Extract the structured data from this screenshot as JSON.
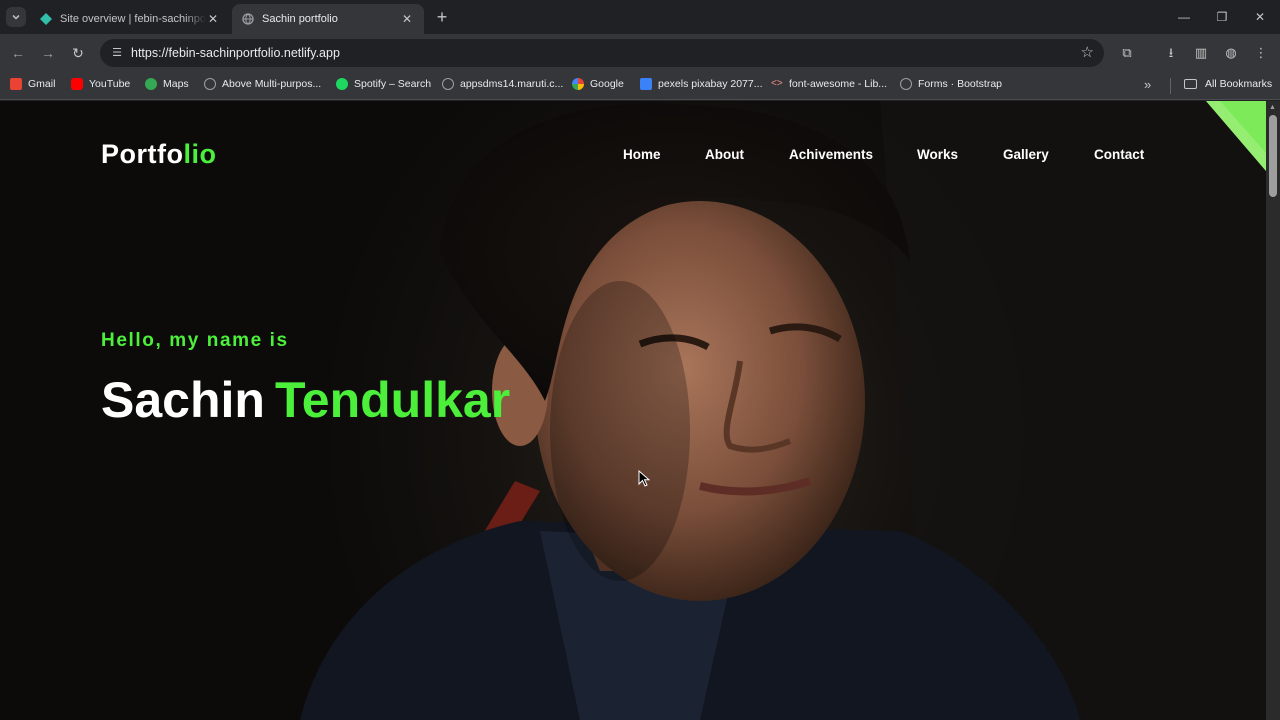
{
  "browser": {
    "tabs": [
      {
        "title": "Site overview | febin-sachinportfolio",
        "active": false
      },
      {
        "title": "Sachin portfolio",
        "active": true
      }
    ],
    "url": "https://febin-sachinportfolio.netlify.app",
    "bookmarks": [
      {
        "label": "Gmail",
        "icon": "gmail-icon",
        "color": "#ea4335"
      },
      {
        "label": "YouTube",
        "icon": "youtube-icon",
        "color": "#ff0000"
      },
      {
        "label": "Maps",
        "icon": "maps-icon",
        "color": "#34a853"
      },
      {
        "label": "Above Multi-purpos...",
        "icon": "globe-icon",
        "color": "#9aa0a6"
      },
      {
        "label": "Spotify – Search",
        "icon": "spotify-icon",
        "color": "#1ed760"
      },
      {
        "label": "appsdms14.maruti.c...",
        "icon": "globe-icon",
        "color": "#9aa0a6"
      },
      {
        "label": "Google",
        "icon": "google-icon",
        "color": "#4285f4"
      },
      {
        "label": "pexels pixabay 2077...",
        "icon": "pexels-icon",
        "color": "#3b82f6"
      },
      {
        "label": "font-awesome - Lib...",
        "icon": "code-icon",
        "color": "#f28b82"
      },
      {
        "label": "Forms · Bootstrap",
        "icon": "globe-icon",
        "color": "#9aa0a6"
      }
    ],
    "all_bookmarks": "All Bookmarks"
  },
  "site": {
    "logo_main": "Portfo",
    "logo_accent": "lio",
    "nav": [
      "Home",
      "About",
      "Achivements",
      "Works",
      "Gallery",
      "Contact"
    ],
    "hero": {
      "greeting": "Hello, my name is",
      "first_name": "Sachin",
      "last_name": "Tendulkar"
    },
    "accent_color": "#4cf03b"
  }
}
